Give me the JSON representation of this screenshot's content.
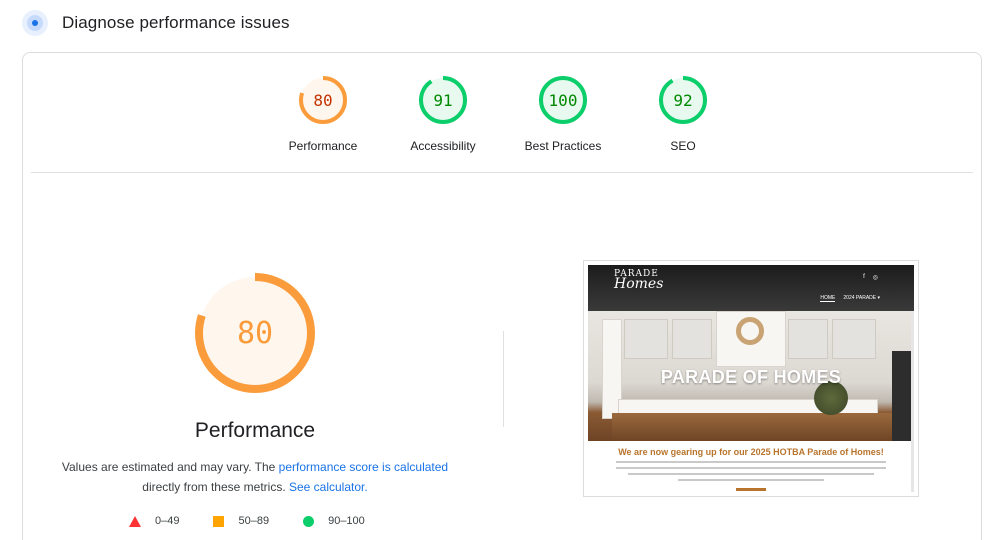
{
  "header": {
    "title": "Diagnose performance issues",
    "icon": "lighthouse-icon"
  },
  "colors": {
    "orange": "#fa9c3c",
    "green": "#0cce6b",
    "red": "#ff3333",
    "link": "#1a73e8"
  },
  "gauges": [
    {
      "label": "Performance",
      "score": "80",
      "value": 80,
      "rating": "average"
    },
    {
      "label": "Accessibility",
      "score": "91",
      "value": 91,
      "rating": "pass"
    },
    {
      "label": "Best Practices",
      "score": "100",
      "value": 100,
      "rating": "pass"
    },
    {
      "label": "SEO",
      "score": "92",
      "value": 92,
      "rating": "pass"
    }
  ],
  "main": {
    "score": "80",
    "value": 80,
    "title": "Performance",
    "desc_prefix": "Values are estimated and may vary. The ",
    "desc_link": "performance score is calculated",
    "desc_middle": " directly from these metrics. ",
    "desc_link2": "See calculator.",
    "legend": [
      {
        "range": "0–49",
        "shape": "triangle"
      },
      {
        "range": "50–89",
        "shape": "square"
      },
      {
        "range": "90–100",
        "shape": "circle"
      }
    ]
  },
  "screenshot": {
    "logo_top": "PARADE",
    "logo_script": "Homes",
    "menu": [
      "HOME",
      "2024 PARADE ▾"
    ],
    "social": [
      "f",
      "◎"
    ],
    "hero_title": "PARADE OF HOMES",
    "band_title": "We are now gearing up for our 2025 HOTBA Parade of Homes!"
  }
}
